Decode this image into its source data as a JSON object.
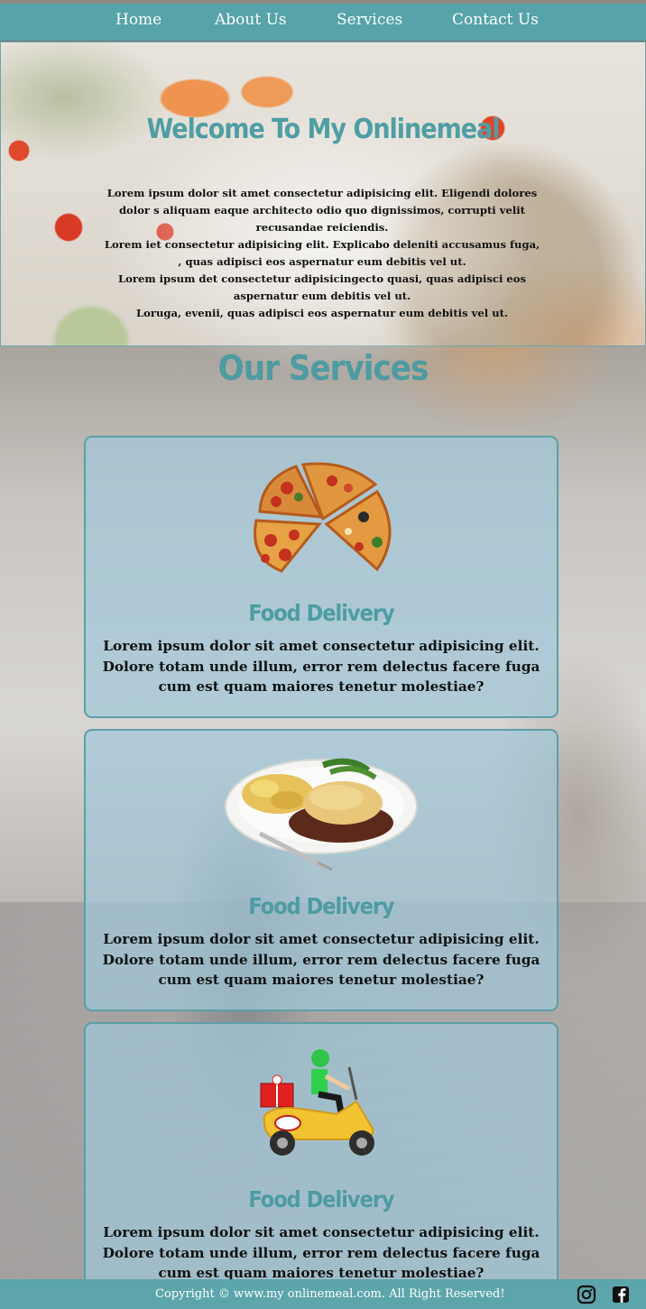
{
  "nav": {
    "items": [
      {
        "label": "Home"
      },
      {
        "label": "About Us"
      },
      {
        "label": "Services"
      },
      {
        "label": "Contact Us"
      }
    ]
  },
  "hero": {
    "title": "Welcome To My Onlinemeal",
    "paragraphs": [
      "Lorem ipsum dolor sit amet consectetur adipisicing elit. Eligendi dolores dolor s aliquam eaque architecto odio quo dignissimos, corrupti velit recusandae reiciendis.",
      "Lorem iet consectetur adipisicing elit. Explicabo deleniti accusamus fuga, , quas adipisci eos aspernatur eum debitis vel ut.",
      "Lorem ipsum det consectetur adipisicingecto quasi, quas adipisci eos aspernatur eum debitis vel ut.",
      "Loruga, evenii, quas adipisci eos aspernatur eum debitis vel ut."
    ]
  },
  "services": {
    "title": "Our Services",
    "cards": [
      {
        "title": "Food Delivery",
        "image": "pizza-image",
        "text": "Lorem ipsum dolor sit amet consectetur adipisicing elit. Dolore totam unde illum, error rem delectus facere fuga cum est quam maiores tenetur molestiae?"
      },
      {
        "title": "Food Delivery",
        "image": "meal-plate-image",
        "text": "Lorem ipsum dolor sit amet consectetur adipisicing elit. Dolore totam unde illum, error rem delectus facere fuga cum est quam maiores tenetur molestiae?"
      },
      {
        "title": "Food Delivery",
        "image": "scooter-delivery-image",
        "text": "Lorem ipsum dolor sit amet consectetur adipisicing elit. Dolore totam unde illum, error rem delectus facere fuga cum est quam maiores tenetur molestiae?"
      }
    ]
  },
  "footer": {
    "copyright": "Copyright © www.my onlinemeal.com. All Right Reserved!",
    "social": [
      "instagram-icon",
      "facebook-icon"
    ]
  },
  "colors": {
    "accent": "#56a3a9",
    "title": "#4f9ea4",
    "card_bg": "#a0c8da"
  }
}
